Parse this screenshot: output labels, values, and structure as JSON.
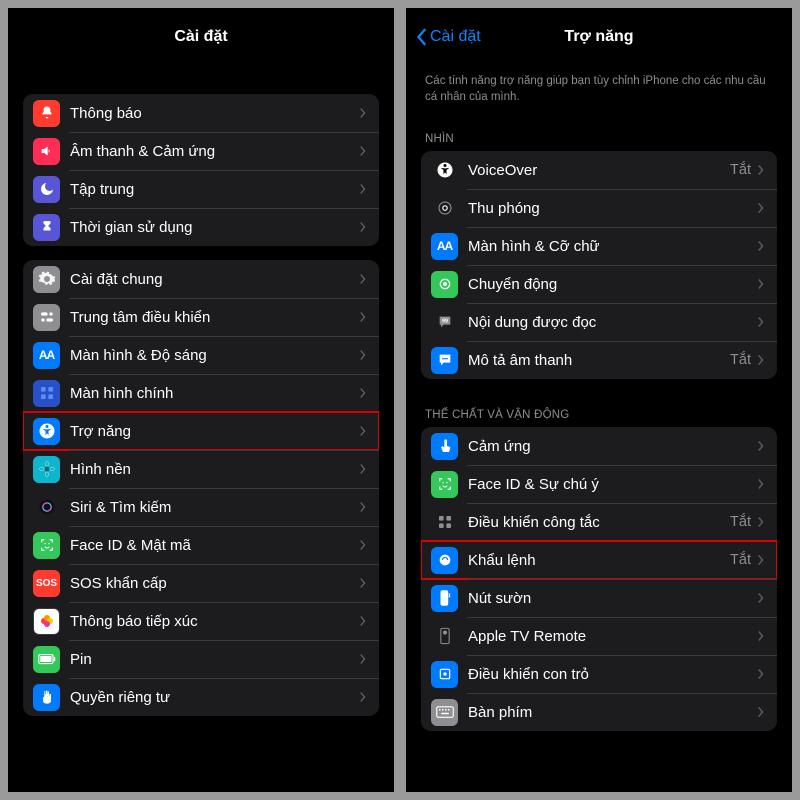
{
  "left": {
    "title": "Cài đặt",
    "groups": [
      [
        {
          "id": "notifications",
          "label": "Thông báo",
          "icon_bg": "#ff3b30",
          "glyph": "bell"
        },
        {
          "id": "sounds",
          "label": "Âm thanh & Cảm ứng",
          "icon_bg": "#ff2d55",
          "glyph": "speaker"
        },
        {
          "id": "focus",
          "label": "Tập trung",
          "icon_bg": "#5856d6",
          "glyph": "moon"
        },
        {
          "id": "screentime",
          "label": "Thời gian sử dụng",
          "icon_bg": "#5856d6",
          "glyph": "hourglass"
        }
      ],
      [
        {
          "id": "general",
          "label": "Cài đặt chung",
          "icon_bg": "#8e8e93",
          "glyph": "gear"
        },
        {
          "id": "control-center",
          "label": "Trung tâm điều khiển",
          "icon_bg": "#8e8e93",
          "glyph": "switches"
        },
        {
          "id": "display",
          "label": "Màn hình & Độ sáng",
          "icon_bg": "#007aff",
          "glyph": "AA"
        },
        {
          "id": "home-screen",
          "label": "Màn hình chính",
          "icon_bg": "#2850c9",
          "glyph": "grid"
        },
        {
          "id": "accessibility",
          "label": "Trợ năng",
          "icon_bg": "#007aff",
          "glyph": "access",
          "highlight": true
        },
        {
          "id": "wallpaper",
          "label": "Hình nền",
          "icon_bg": "#0fb5cc",
          "glyph": "flower"
        },
        {
          "id": "siri",
          "label": "Siri & Tìm kiếm",
          "icon_bg": "#1c1c1e",
          "glyph": "siri"
        },
        {
          "id": "faceid",
          "label": "Face ID & Mật mã",
          "icon_bg": "#34c759",
          "glyph": "face"
        },
        {
          "id": "sos",
          "label": "SOS khẩn cấp",
          "icon_bg": "#ff3b30",
          "glyph": "SOS"
        },
        {
          "id": "exposure",
          "label": "Thông báo tiếp xúc",
          "icon_bg": "#ffffff",
          "glyph": "exposure"
        },
        {
          "id": "battery",
          "label": "Pin",
          "icon_bg": "#34c759",
          "glyph": "battery"
        },
        {
          "id": "privacy",
          "label": "Quyền riêng tư",
          "icon_bg": "#007aff",
          "glyph": "hand"
        }
      ]
    ]
  },
  "right": {
    "back": "Cài đặt",
    "title": "Trợ năng",
    "desc": "Các tính năng trợ năng giúp bạn tùy chỉnh iPhone cho các nhu cầu cá nhân của mình.",
    "sections": [
      {
        "header": "NHÌN",
        "rows": [
          {
            "id": "voiceover",
            "label": "VoiceOver",
            "value": "Tắt",
            "icon_bg": "#1c1c1e",
            "glyph": "access-wb"
          },
          {
            "id": "zoom",
            "label": "Thu phóng",
            "icon_bg": "#1c1c1e",
            "glyph": "zoom"
          },
          {
            "id": "display-text",
            "label": "Màn hình & Cỡ chữ",
            "icon_bg": "#007aff",
            "glyph": "AA"
          },
          {
            "id": "motion",
            "label": "Chuyển động",
            "icon_bg": "#34c759",
            "glyph": "motion"
          },
          {
            "id": "spoken",
            "label": "Nội dung được đọc",
            "icon_bg": "#1c1c1e",
            "glyph": "bubble"
          },
          {
            "id": "audio-desc",
            "label": "Mô tả âm thanh",
            "value": "Tắt",
            "icon_bg": "#007aff",
            "glyph": "bubble-dots"
          }
        ]
      },
      {
        "header": "THỂ CHẤT VÀ VẬN ĐỘNG",
        "rows": [
          {
            "id": "touch",
            "label": "Cảm ứng",
            "icon_bg": "#007aff",
            "glyph": "tap"
          },
          {
            "id": "face-attention",
            "label": "Face ID & Sự chú ý",
            "icon_bg": "#34c759",
            "glyph": "face"
          },
          {
            "id": "switch-control",
            "label": "Điều khiển công tắc",
            "value": "Tắt",
            "icon_bg": "#1c1c1e",
            "glyph": "switch4"
          },
          {
            "id": "voice-control",
            "label": "Khẩu lệnh",
            "value": "Tắt",
            "icon_bg": "#007aff",
            "glyph": "voice",
            "highlight": true
          },
          {
            "id": "side-button",
            "label": "Nút sườn",
            "icon_bg": "#007aff",
            "glyph": "side"
          },
          {
            "id": "apple-tv",
            "label": "Apple TV Remote",
            "icon_bg": "#1c1c1e",
            "glyph": "remote"
          },
          {
            "id": "pointer",
            "label": "Điều khiển con trỏ",
            "icon_bg": "#007aff",
            "glyph": "pointer"
          },
          {
            "id": "keyboards",
            "label": "Bàn phím",
            "icon_bg": "#8e8e93",
            "glyph": "keyboard"
          }
        ]
      }
    ]
  }
}
